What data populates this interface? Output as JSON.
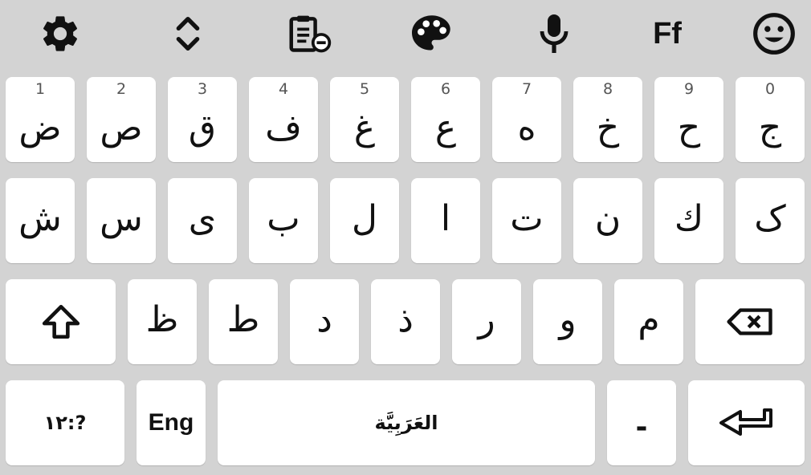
{
  "toolbar": {
    "icons": [
      "gear-icon",
      "move-cursor-icon",
      "clipboard-icon",
      "palette-icon",
      "microphone-icon",
      "fonts-icon",
      "emoji-icon"
    ],
    "fonts_label": "Ff"
  },
  "rows": {
    "row1": [
      {
        "num": "1",
        "glyph": "ض"
      },
      {
        "num": "2",
        "glyph": "ص"
      },
      {
        "num": "3",
        "glyph": "ق"
      },
      {
        "num": "4",
        "glyph": "ف"
      },
      {
        "num": "5",
        "glyph": "غ"
      },
      {
        "num": "6",
        "glyph": "ع"
      },
      {
        "num": "7",
        "glyph": "ه"
      },
      {
        "num": "8",
        "glyph": "خ"
      },
      {
        "num": "9",
        "glyph": "ح"
      },
      {
        "num": "0",
        "glyph": "ج"
      }
    ],
    "row2": [
      {
        "glyph": "ش"
      },
      {
        "glyph": "س"
      },
      {
        "glyph": "ى"
      },
      {
        "glyph": "ب"
      },
      {
        "glyph": "ل"
      },
      {
        "glyph": "ا"
      },
      {
        "glyph": "ت"
      },
      {
        "glyph": "ن"
      },
      {
        "glyph": "ك"
      },
      {
        "glyph": "ک"
      }
    ],
    "row3": [
      {
        "glyph": "ظ"
      },
      {
        "glyph": "ط"
      },
      {
        "glyph": "د"
      },
      {
        "glyph": "ذ"
      },
      {
        "glyph": "ر"
      },
      {
        "glyph": "و"
      },
      {
        "glyph": "م"
      }
    ]
  },
  "bottom": {
    "symbols_label": "١٢:?",
    "lang_label": "Eng",
    "space_label": "العَرَبِيَّة",
    "dash_label": "-"
  },
  "special_icons": {
    "shift": "shift-icon",
    "backspace": "backspace-icon",
    "enter": "enter-icon"
  },
  "colors": {
    "background": "#d3d3d3",
    "key": "#ffffff",
    "text": "#111111",
    "number_hint": "#555555"
  }
}
